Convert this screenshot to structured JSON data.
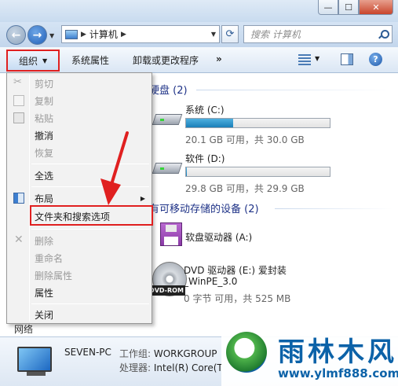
{
  "window": {
    "minimize_glyph": "—",
    "maximize_glyph": "☐",
    "close_glyph": "✕"
  },
  "address": {
    "path": "计算机",
    "search_placeholder": "搜索 计算机"
  },
  "toolbar": {
    "organize": "组织",
    "system_properties": "系统属性",
    "uninstall": "卸载或更改程序",
    "more": "»",
    "help": "?"
  },
  "content": {
    "hdd_group": "硬盘 (2)",
    "removable_group": "有可移动存储的设备 (2)",
    "drives": [
      {
        "name": "系统 (C:)",
        "info": "20.1 GB 可用，共 30.0 GB",
        "used_fraction": 0.33
      },
      {
        "name": "软件 (D:)",
        "info": "29.8 GB 可用，共 29.9 GB",
        "used_fraction": 0.0
      }
    ],
    "floppy": {
      "name": "软盘驱动器 (A:)"
    },
    "dvd": {
      "name_line1": "DVD 驱动器 (E:) 爱封装",
      "name_line2": "_WinPE_3.0",
      "info": "0 字节 可用，共 525 MB",
      "icon_label": "DVD-ROM"
    }
  },
  "menu": {
    "items": [
      {
        "label": "剪切",
        "disabled": true,
        "icon": "scissors-icon"
      },
      {
        "label": "复制",
        "disabled": true,
        "icon": "copy-icon"
      },
      {
        "label": "粘贴",
        "disabled": true,
        "icon": "paste-icon"
      },
      {
        "label": "撤消",
        "disabled": false
      },
      {
        "label": "恢复",
        "disabled": true
      },
      {
        "label": "全选",
        "disabled": false
      },
      {
        "label": "布局",
        "disabled": false,
        "icon": "layout-icon",
        "submenu": true
      },
      {
        "label": "文件夹和搜索选项",
        "disabled": false,
        "highlighted": true
      },
      {
        "label": "删除",
        "disabled": true,
        "icon": "delete-icon"
      },
      {
        "label": "重命名",
        "disabled": true
      },
      {
        "label": "删除属性",
        "disabled": true
      },
      {
        "label": "属性",
        "disabled": false
      },
      {
        "label": "关闭",
        "disabled": false
      }
    ]
  },
  "status": {
    "nav_network": "网络",
    "pc_name": "SEVEN-PC",
    "workgroup_key": "工作组:",
    "workgroup_val": "WORKGROUP",
    "cpu_key": "处理器:",
    "cpu_val": "Intel(R) Core(T"
  },
  "watermark": {
    "title": "雨林木风",
    "url": "www.ylmf888.com"
  },
  "colors": {
    "highlight_red": "#e02020",
    "group_header": "#1e3287",
    "watermark_blue": "#0c62a8"
  }
}
